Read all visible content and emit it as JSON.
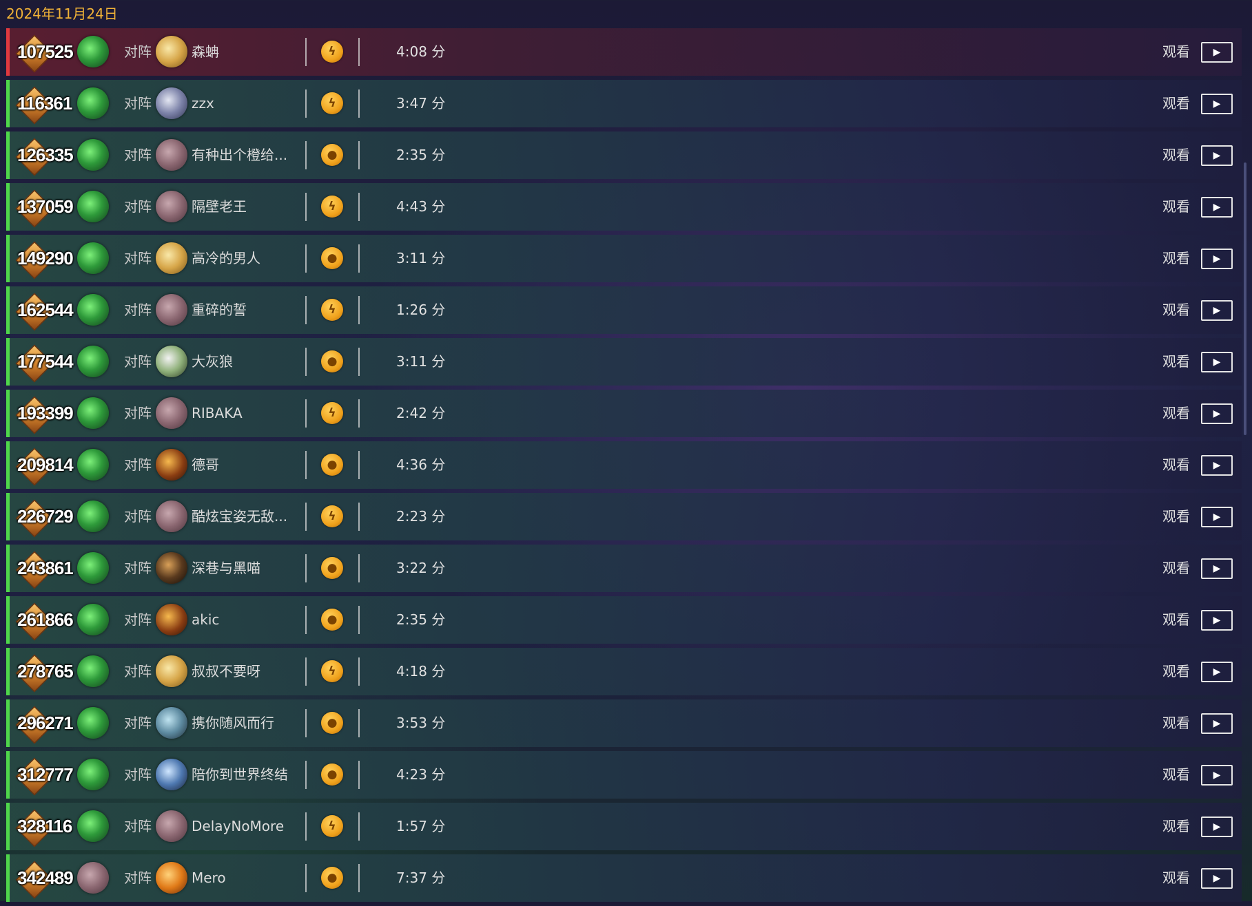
{
  "date": "2024年11月24日",
  "colors": {
    "accent_date": "#f0b237",
    "win_bar": "#4fd64b",
    "loss_bar": "#e0393f",
    "mode_icon": "#f0a21c"
  },
  "icons": {
    "rank": "diamond-rank-icon",
    "mode_fire": "fire-icon",
    "mode_coin": "coin-icon",
    "play": "play-icon"
  },
  "matches": [
    {
      "result": "loss",
      "rank": "107525",
      "my_hero": "green-hero",
      "vs": "对阵",
      "opp_hero": "gold",
      "opp": "森蚺",
      "mode": "fire",
      "mode_glyph": "ϟ",
      "duration": "4:08 分",
      "watch": "观看",
      "play": "▶"
    },
    {
      "result": "win",
      "rank": "116361",
      "my_hero": "green-hero",
      "vs": "对阵",
      "opp_hero": "steel",
      "opp": "zzx",
      "mode": "fire",
      "mode_glyph": "ϟ",
      "duration": "3:47 分",
      "watch": "观看",
      "play": "▶"
    },
    {
      "result": "win",
      "rank": "126335",
      "my_hero": "green-hero",
      "vs": "对阵",
      "opp_hero": "mauve",
      "opp": "有种出个橙给...",
      "mode": "coin",
      "mode_glyph": "●",
      "duration": "2:35 分",
      "watch": "观看",
      "play": "▶"
    },
    {
      "result": "win",
      "rank": "137059",
      "my_hero": "green-hero",
      "vs": "对阵",
      "opp_hero": "mauve",
      "opp": "隔壁老王",
      "mode": "fire",
      "mode_glyph": "ϟ",
      "duration": "4:43 分",
      "watch": "观看",
      "play": "▶"
    },
    {
      "result": "win",
      "rank": "149290",
      "my_hero": "green-hero",
      "vs": "对阵",
      "opp_hero": "gold",
      "opp": "高冷的男人",
      "mode": "coin",
      "mode_glyph": "●",
      "duration": "3:11 分",
      "watch": "观看",
      "play": "▶"
    },
    {
      "result": "win",
      "rank": "162544",
      "my_hero": "green-hero",
      "vs": "对阵",
      "opp_hero": "mauve",
      "opp": "重碎的誓",
      "mode": "fire",
      "mode_glyph": "ϟ",
      "duration": "1:26 分",
      "watch": "观看",
      "play": "▶"
    },
    {
      "result": "win",
      "rank": "177544",
      "my_hero": "green-hero",
      "vs": "对阵",
      "opp_hero": "white",
      "opp": "大灰狼",
      "mode": "coin",
      "mode_glyph": "●",
      "duration": "3:11 分",
      "watch": "观看",
      "play": "▶"
    },
    {
      "result": "win",
      "rank": "193399",
      "my_hero": "green-hero",
      "vs": "对阵",
      "opp_hero": "mauve",
      "opp": "RIBAKA",
      "mode": "fire",
      "mode_glyph": "ϟ",
      "duration": "2:42 分",
      "watch": "观看",
      "play": "▶"
    },
    {
      "result": "win",
      "rank": "209814",
      "my_hero": "green-hero",
      "vs": "对阵",
      "opp_hero": "fire",
      "opp": "德哥",
      "mode": "coin",
      "mode_glyph": "●",
      "duration": "4:36 分",
      "watch": "观看",
      "play": "▶"
    },
    {
      "result": "win",
      "rank": "226729",
      "my_hero": "green-hero",
      "vs": "对阵",
      "opp_hero": "mauve",
      "opp": "酷炫宝姿无敌...",
      "mode": "fire",
      "mode_glyph": "ϟ",
      "duration": "2:23 分",
      "watch": "观看",
      "play": "▶"
    },
    {
      "result": "win",
      "rank": "243861",
      "my_hero": "green-hero",
      "vs": "对阵",
      "opp_hero": "dark",
      "opp": "深巷与黑喵",
      "mode": "coin",
      "mode_glyph": "●",
      "duration": "3:22 分",
      "watch": "观看",
      "play": "▶"
    },
    {
      "result": "win",
      "rank": "261866",
      "my_hero": "green-hero",
      "vs": "对阵",
      "opp_hero": "fire",
      "opp": "akic",
      "mode": "coin",
      "mode_glyph": "●",
      "duration": "2:35 分",
      "watch": "观看",
      "play": "▶"
    },
    {
      "result": "win",
      "rank": "278765",
      "my_hero": "green-hero",
      "vs": "对阵",
      "opp_hero": "gold",
      "opp": "叔叔不要呀",
      "mode": "fire",
      "mode_glyph": "ϟ",
      "duration": "4:18 分",
      "watch": "观看",
      "play": "▶"
    },
    {
      "result": "win",
      "rank": "296271",
      "my_hero": "green-hero",
      "vs": "对阵",
      "opp_hero": "chest",
      "opp": "携你随风而行",
      "mode": "coin",
      "mode_glyph": "●",
      "duration": "3:53 分",
      "watch": "观看",
      "play": "▶"
    },
    {
      "result": "win",
      "rank": "312777",
      "my_hero": "green-hero",
      "vs": "对阵",
      "opp_hero": "sword",
      "opp": "陪你到世界终结",
      "mode": "coin",
      "mode_glyph": "●",
      "duration": "4:23 分",
      "watch": "观看",
      "play": "▶"
    },
    {
      "result": "win",
      "rank": "328116",
      "my_hero": "green-hero",
      "vs": "对阵",
      "opp_hero": "mauve",
      "opp": "DelayNoMore",
      "mode": "fire",
      "mode_glyph": "ϟ",
      "duration": "1:57 分",
      "watch": "观看",
      "play": "▶"
    },
    {
      "result": "win",
      "rank": "342489",
      "my_hero": "mauve-hero",
      "vs": "对阵",
      "opp_hero": "flame",
      "opp": "Mero",
      "mode": "coin",
      "mode_glyph": "●",
      "duration": "7:37 分",
      "watch": "观看",
      "play": "▶"
    }
  ]
}
